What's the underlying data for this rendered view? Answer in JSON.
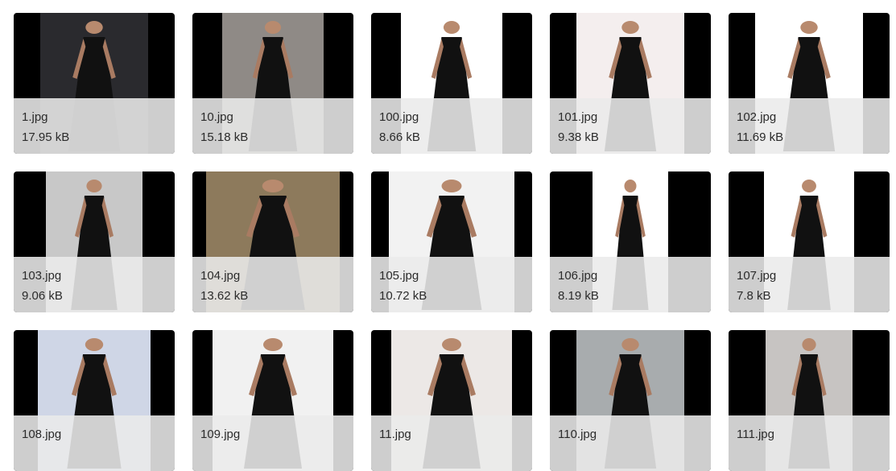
{
  "files": [
    {
      "name": "1.jpg",
      "size": "17.95 kB",
      "bg": "#2a2a2e",
      "icon": "photo-thumbnail"
    },
    {
      "name": "10.jpg",
      "size": "15.18 kB",
      "bg": "#8f8a86",
      "icon": "photo-thumbnail"
    },
    {
      "name": "100.jpg",
      "size": "8.66 kB",
      "bg": "#ffffff",
      "icon": "photo-thumbnail"
    },
    {
      "name": "101.jpg",
      "size": "9.38 kB",
      "bg": "#f4eeee",
      "icon": "photo-thumbnail"
    },
    {
      "name": "102.jpg",
      "size": "11.69 kB",
      "bg": "#ffffff",
      "icon": "photo-thumbnail"
    },
    {
      "name": "103.jpg",
      "size": "9.06 kB",
      "bg": "#c8c8c8",
      "icon": "photo-thumbnail"
    },
    {
      "name": "104.jpg",
      "size": "13.62 kB",
      "bg": "#8d7a5c",
      "icon": "photo-thumbnail"
    },
    {
      "name": "105.jpg",
      "size": "10.72 kB",
      "bg": "#f2f2f2",
      "icon": "photo-thumbnail"
    },
    {
      "name": "106.jpg",
      "size": "8.19 kB",
      "bg": "#ffffff",
      "icon": "photo-thumbnail"
    },
    {
      "name": "107.jpg",
      "size": "7.8 kB",
      "bg": "#ffffff",
      "icon": "photo-thumbnail"
    },
    {
      "name": "108.jpg",
      "size": "",
      "bg": "#cfd6e6",
      "icon": "photo-thumbnail"
    },
    {
      "name": "109.jpg",
      "size": "",
      "bg": "#f1f1f1",
      "icon": "photo-thumbnail"
    },
    {
      "name": "11.jpg",
      "size": "",
      "bg": "#ece8e6",
      "icon": "photo-thumbnail"
    },
    {
      "name": "110.jpg",
      "size": "",
      "bg": "#a8acae",
      "icon": "photo-thumbnail"
    },
    {
      "name": "111.jpg",
      "size": "",
      "bg": "#c7c4c2",
      "icon": "photo-thumbnail"
    }
  ]
}
